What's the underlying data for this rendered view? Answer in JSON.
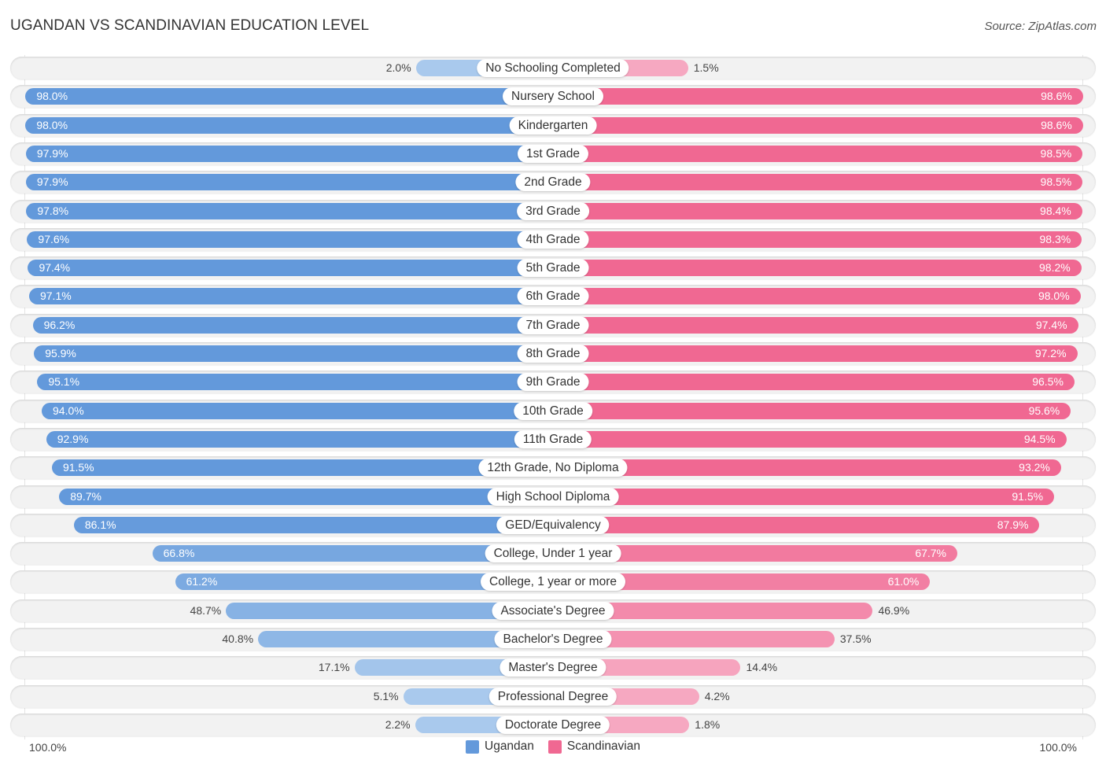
{
  "title": "UGANDAN VS SCANDINAVIAN EDUCATION LEVEL",
  "source": "Source: ZipAtlas.com",
  "colors": {
    "ugandan_strong": "#6399db",
    "ugandan_light": "#a9c9ed",
    "scandinavian_strong": "#f06892",
    "scandinavian_light": "#f6a8c1"
  },
  "axis": {
    "left_label": "100.0%",
    "right_label": "100.0%"
  },
  "legend": [
    {
      "name": "Ugandan",
      "color": "#6399db"
    },
    {
      "name": "Scandinavian",
      "color": "#f06892"
    }
  ],
  "chart_data": {
    "type": "bar",
    "orientation": "horizontal-diverging",
    "title": "UGANDAN VS SCANDINAVIAN EDUCATION LEVEL",
    "xlabel": "",
    "ylabel": "",
    "xlim": [
      0,
      100
    ],
    "legend_position": "bottom",
    "categories": [
      "No Schooling Completed",
      "Nursery School",
      "Kindergarten",
      "1st Grade",
      "2nd Grade",
      "3rd Grade",
      "4th Grade",
      "5th Grade",
      "6th Grade",
      "7th Grade",
      "8th Grade",
      "9th Grade",
      "10th Grade",
      "11th Grade",
      "12th Grade, No Diploma",
      "High School Diploma",
      "GED/Equivalency",
      "College, Under 1 year",
      "College, 1 year or more",
      "Associate's Degree",
      "Bachelor's Degree",
      "Master's Degree",
      "Professional Degree",
      "Doctorate Degree"
    ],
    "series": [
      {
        "name": "Ugandan",
        "side": "left",
        "values": [
          2.0,
          98.0,
          98.0,
          97.9,
          97.9,
          97.8,
          97.6,
          97.4,
          97.1,
          96.2,
          95.9,
          95.1,
          94.0,
          92.9,
          91.5,
          89.7,
          86.1,
          66.8,
          61.2,
          48.7,
          40.8,
          17.1,
          5.1,
          2.2
        ],
        "labels": [
          "2.0%",
          "98.0%",
          "98.0%",
          "97.9%",
          "97.9%",
          "97.8%",
          "97.6%",
          "97.4%",
          "97.1%",
          "96.2%",
          "95.9%",
          "95.1%",
          "94.0%",
          "92.9%",
          "91.5%",
          "89.7%",
          "86.1%",
          "66.8%",
          "61.2%",
          "48.7%",
          "40.8%",
          "17.1%",
          "5.1%",
          "2.2%"
        ]
      },
      {
        "name": "Scandinavian",
        "side": "right",
        "values": [
          1.5,
          98.6,
          98.6,
          98.5,
          98.5,
          98.4,
          98.3,
          98.2,
          98.0,
          97.4,
          97.2,
          96.5,
          95.6,
          94.5,
          93.2,
          91.5,
          87.9,
          67.7,
          61.0,
          46.9,
          37.5,
          14.4,
          4.2,
          1.8
        ],
        "labels": [
          "1.5%",
          "98.6%",
          "98.6%",
          "98.5%",
          "98.5%",
          "98.4%",
          "98.3%",
          "98.2%",
          "98.0%",
          "97.4%",
          "97.2%",
          "96.5%",
          "95.6%",
          "94.5%",
          "93.2%",
          "91.5%",
          "87.9%",
          "67.7%",
          "61.0%",
          "46.9%",
          "37.5%",
          "14.4%",
          "4.2%",
          "1.8%"
        ]
      }
    ]
  }
}
